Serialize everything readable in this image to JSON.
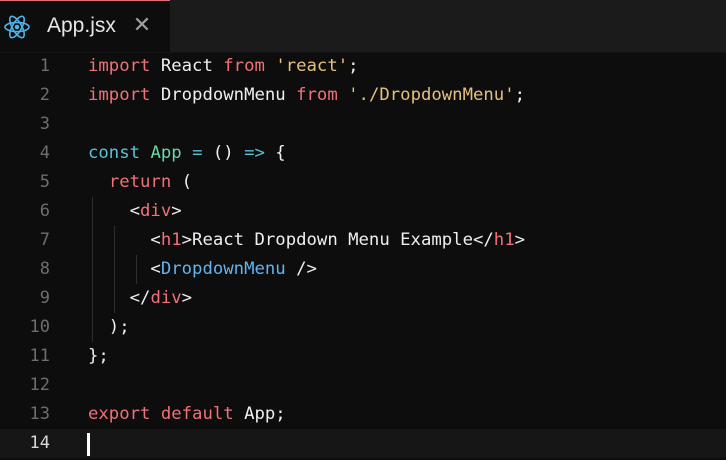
{
  "tab": {
    "icon": "react-icon",
    "title": "App.jsx",
    "close": "✕",
    "accent": "#e06c75"
  },
  "editor": {
    "active_line": 14,
    "line_numbers": [
      "1",
      "2",
      "3",
      "4",
      "5",
      "6",
      "7",
      "8",
      "9",
      "10",
      "11",
      "12",
      "13",
      "14"
    ],
    "lines": [
      [
        [
          "kw",
          "import"
        ],
        [
          "pl",
          " React "
        ],
        [
          "kw",
          "from"
        ],
        [
          "pl",
          " "
        ],
        [
          "str",
          "'react'"
        ],
        [
          "pl",
          ";"
        ]
      ],
      [
        [
          "kw",
          "import"
        ],
        [
          "pl",
          " DropdownMenu "
        ],
        [
          "kw",
          "from"
        ],
        [
          "pl",
          " "
        ],
        [
          "str",
          "'./DropdownMenu'"
        ],
        [
          "pl",
          ";"
        ]
      ],
      [],
      [
        [
          "op",
          "const"
        ],
        [
          "pl",
          " "
        ],
        [
          "fn",
          "App"
        ],
        [
          "pl",
          " "
        ],
        [
          "op",
          "="
        ],
        [
          "pl",
          " () "
        ],
        [
          "op",
          "=>"
        ],
        [
          "pl",
          " {"
        ]
      ],
      [
        [
          "pl",
          "  "
        ],
        [
          "kw",
          "return"
        ],
        [
          "pl",
          " ("
        ]
      ],
      [
        [
          "pl",
          "    <"
        ],
        [
          "tag",
          "div"
        ],
        [
          "pl",
          ">"
        ]
      ],
      [
        [
          "pl",
          "      <"
        ],
        [
          "tag",
          "h1"
        ],
        [
          "pl",
          ">React Dropdown Menu Example</"
        ],
        [
          "tag",
          "h1"
        ],
        [
          "pl",
          ">"
        ]
      ],
      [
        [
          "pl",
          "      <"
        ],
        [
          "comp",
          "DropdownMenu"
        ],
        [
          "pl",
          " />"
        ]
      ],
      [
        [
          "pl",
          "    </"
        ],
        [
          "tag",
          "div"
        ],
        [
          "pl",
          ">"
        ]
      ],
      [
        [
          "pl",
          "  );"
        ]
      ],
      [
        [
          "pl",
          "};"
        ]
      ],
      [],
      [
        [
          "kw",
          "export"
        ],
        [
          "pl",
          " "
        ],
        [
          "kw",
          "default"
        ],
        [
          "pl",
          " App;"
        ]
      ],
      []
    ]
  },
  "colors": {
    "background": "#0d0d0d",
    "keyword": "#f07178",
    "string": "#e5c07b",
    "function": "#6ad6a8",
    "operator": "#56c4d8",
    "component": "#61b4f0",
    "text": "#efefef"
  }
}
